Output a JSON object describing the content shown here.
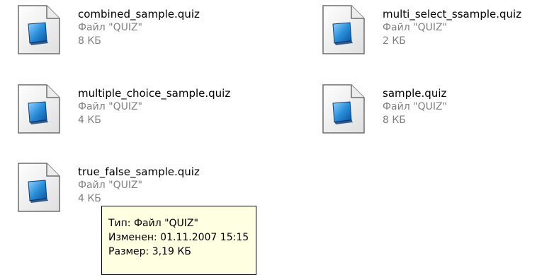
{
  "files": [
    {
      "name": "combined_sample.quiz",
      "type": "Файл \"QUIZ\"",
      "size": "8 КБ",
      "icon": "quiz-file-icon"
    },
    {
      "name": "multi_select_ssample.quiz",
      "type": "Файл \"QUIZ\"",
      "size": "2 КБ",
      "icon": "quiz-file-icon"
    },
    {
      "name": "multiple_choice_sample.quiz",
      "type": "Файл \"QUIZ\"",
      "size": "4 КБ",
      "icon": "quiz-file-icon"
    },
    {
      "name": "sample.quiz",
      "type": "Файл \"QUIZ\"",
      "size": "8 КБ",
      "icon": "quiz-file-icon"
    },
    {
      "name": "true_false_sample.quiz",
      "type": "Файл \"QUIZ\"",
      "size": "4 КБ",
      "icon": "quiz-file-icon"
    }
  ],
  "tooltip": {
    "type_line": "Тип: Файл \"QUIZ\"",
    "modified_line": "Изменен: 01.11.2007 15:15",
    "size_line": "Размер: 3,19 КБ"
  },
  "colors": {
    "background": "#ffffff",
    "name_text": "#000000",
    "detail_text": "#808080",
    "tooltip_background": "#ffffe1",
    "icon_blue": "#2a8fd9"
  }
}
